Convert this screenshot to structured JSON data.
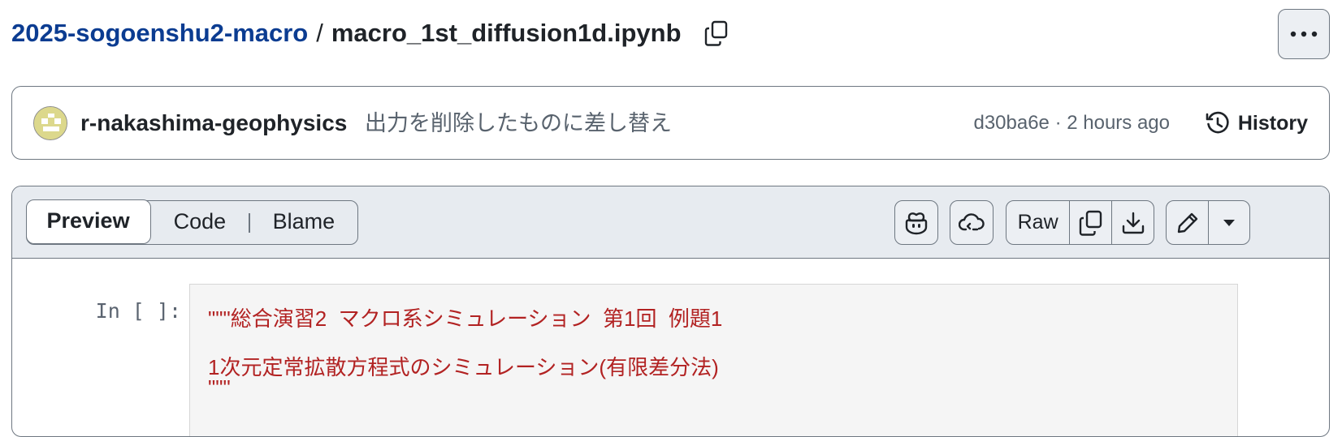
{
  "breadcrumb": {
    "repo": "2025-sogoenshu2-macro",
    "separator": "/",
    "file": "macro_1st_diffusion1d.ipynb"
  },
  "commit": {
    "author": "r-nakashima-geophysics",
    "message": "出力を削除したものに差し替え",
    "meta": "d30ba6e · 2 hours ago",
    "history_label": "History"
  },
  "viewer": {
    "tabs": [
      "Preview",
      "Code",
      "Blame"
    ],
    "raw_label": "Raw"
  },
  "cell": {
    "prompt": "In [ ]:",
    "lines": [
      "\"\"\"総合演習2  マクロ系シミュレーション  第1回  例題1",
      "",
      "1次元定常拡散方程式のシミュレーション(有限差分法)",
      "\"\"\""
    ]
  },
  "colors": {
    "link": "#0b3c91",
    "code_string": "#b22222",
    "header_bg": "#e7ebf0",
    "border": "#6e7781"
  },
  "icons": [
    "copy-icon",
    "kebab-icon",
    "history-icon",
    "copilot-icon",
    "codespaces-icon",
    "download-icon",
    "pencil-icon",
    "triangle-down-icon"
  ]
}
